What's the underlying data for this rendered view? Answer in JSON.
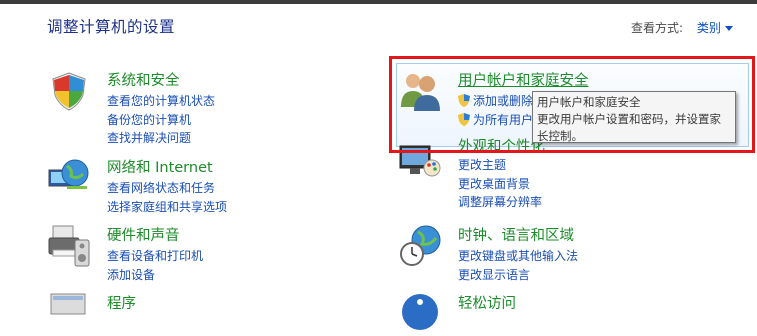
{
  "header": {
    "title": "调整计算机的设置",
    "view_by_label": "查看方式:",
    "view_by_value": "类别"
  },
  "categories": {
    "system": {
      "title": "系统和安全",
      "links": [
        "查看您的计算机状态",
        "备份您的计算机",
        "查找并解决问题"
      ]
    },
    "network": {
      "title": "网络和 Internet",
      "links": [
        "查看网络状态和任务",
        "选择家庭组和共享选项"
      ]
    },
    "hardware": {
      "title": "硬件和声音",
      "links": [
        "查看设备和打印机",
        "添加设备"
      ]
    },
    "programs": {
      "title": "程序"
    },
    "users": {
      "title": "用户帐户和家庭安全",
      "links": [
        "添加或删除",
        "为所有用户"
      ]
    },
    "appearance": {
      "title": "外观和个性化",
      "links": [
        "更改主题",
        "更改桌面背景",
        "调整屏幕分辨率"
      ]
    },
    "clock": {
      "title": "时钟、语言和区域",
      "links": [
        "更改键盘或其他输入法",
        "更改显示语言"
      ]
    },
    "ease": {
      "title": "轻松访问"
    }
  },
  "tooltip": {
    "title": "用户帐户和家庭安全",
    "body": "更改用户帐户设置和密码，并设置家长控制。"
  }
}
